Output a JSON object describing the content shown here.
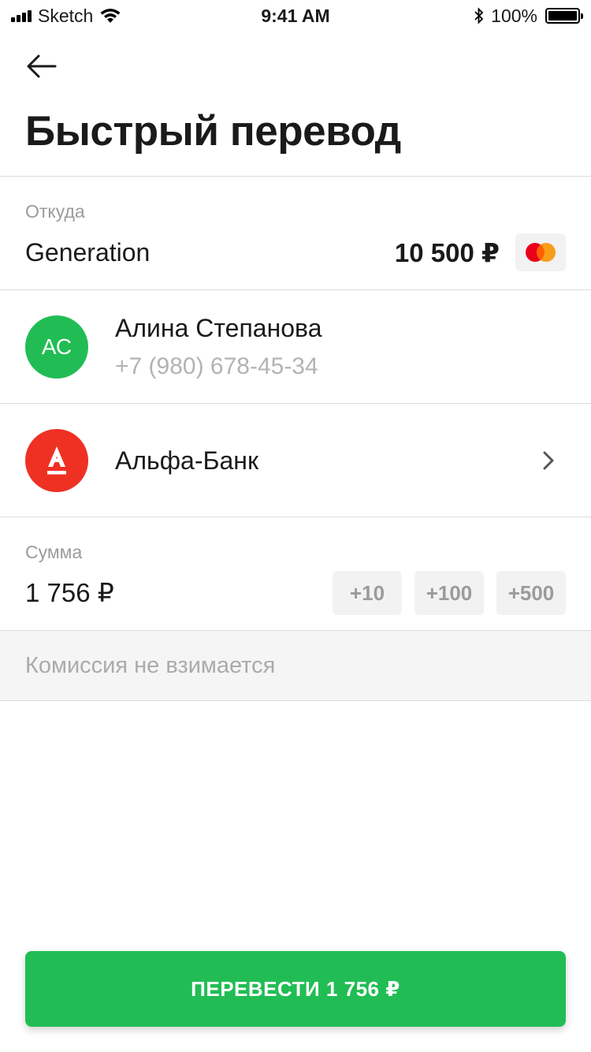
{
  "status_bar": {
    "carrier": "Sketch",
    "time": "9:41 AM",
    "battery": "100%",
    "icons": [
      "signal-icon",
      "wifi-icon",
      "bluetooth-icon",
      "battery-icon"
    ]
  },
  "header": {
    "back_icon": "arrow-left-icon",
    "title": "Быстрый перевод"
  },
  "from": {
    "label": "Откуда",
    "card_name": "Generation",
    "balance": "10 500 ₽",
    "card_logo_icon": "mastercard-icon"
  },
  "recipient": {
    "initials": "АС",
    "name": "Алина Степанова",
    "phone": "+7 (980) 678-45-34",
    "avatar_color": "#21bd54"
  },
  "bank": {
    "name": "Альфа-Банк",
    "logo_icon": "alfa-bank-logo-icon",
    "logo_color": "#ef3124",
    "chevron_icon": "chevron-right-icon"
  },
  "amount": {
    "label": "Сумма",
    "value": "1 756 ₽",
    "quick_add": [
      "+10",
      "+100",
      "+500"
    ]
  },
  "commission": {
    "text": "Комиссия не взимается"
  },
  "action": {
    "label": "ПЕРЕВЕСТИ 1 756 ₽",
    "color": "#21bd54"
  }
}
